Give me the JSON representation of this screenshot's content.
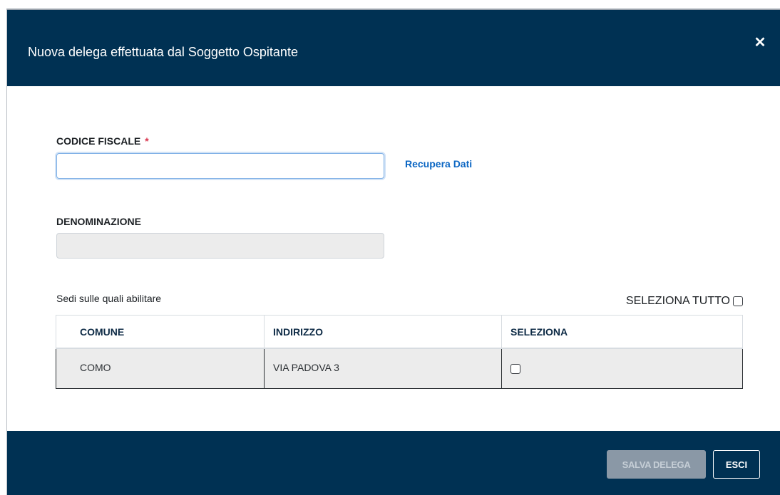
{
  "modal": {
    "title": "Nuova delega effettuata dal Soggetto Ospitante",
    "close_glyph": "✕"
  },
  "form": {
    "codice_fiscale_label": "CODICE FISCALE",
    "required_marker": "*",
    "codice_fiscale_value": "",
    "recupera_label": "Recupera Dati",
    "denominazione_label": "DENOMINAZIONE",
    "denominazione_value": ""
  },
  "sedi": {
    "label": "Sedi sulle quali abilitare",
    "select_all_label": "SELEZIONA TUTTO",
    "columns": [
      "COMUNE",
      "INDIRIZZO",
      "SELEZIONA"
    ],
    "rows": [
      {
        "comune": "COMO",
        "indirizzo": "VIA PADOVA 3",
        "selected": false
      }
    ]
  },
  "footer": {
    "salva_label": "SALVA DELEGA",
    "esci_label": "ESCI"
  },
  "colors": {
    "header_bg": "#003153",
    "link": "#0b66c3",
    "required": "#d9364f",
    "disabled_button": "#8a98a6"
  }
}
